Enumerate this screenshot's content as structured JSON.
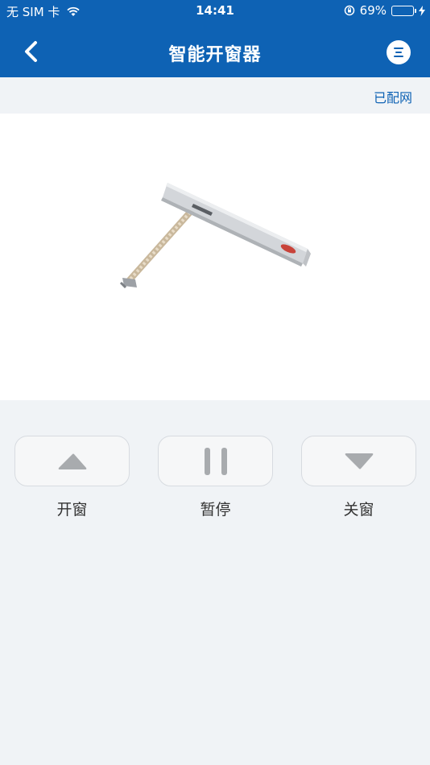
{
  "statusbar": {
    "carrier": "无 SIM 卡",
    "time": "14:41",
    "battery_percent": "69%",
    "battery_level": 0.69
  },
  "navbar": {
    "title": "智能开窗器",
    "back_icon": "chevron-left-icon",
    "menu_icon": "menu-icon"
  },
  "device": {
    "network_status": "已配网"
  },
  "controls": [
    {
      "label": "开窗",
      "icon": "triangle-up-icon"
    },
    {
      "label": "暂停",
      "icon": "pause-icon"
    },
    {
      "label": "关窗",
      "icon": "triangle-down-icon"
    }
  ],
  "colors": {
    "header": "#0e62b4",
    "background": "#f0f3f6",
    "accent": "#0e62b4",
    "icon_gray": "#a8abae"
  }
}
